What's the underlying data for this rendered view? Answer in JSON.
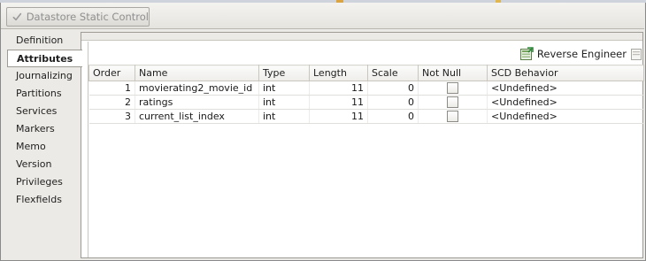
{
  "toolbar": {
    "static_control_label": "Datastore Static Control"
  },
  "nav": {
    "items": [
      {
        "label": "Definition"
      },
      {
        "label": "Attributes"
      },
      {
        "label": "Journalizing"
      },
      {
        "label": "Partitions"
      },
      {
        "label": "Services"
      },
      {
        "label": "Markers"
      },
      {
        "label": "Memo"
      },
      {
        "label": "Version"
      },
      {
        "label": "Privileges"
      },
      {
        "label": "Flexfields"
      }
    ],
    "active": "Attributes"
  },
  "actions": {
    "reverse_engineer_label": "Reverse Engineer"
  },
  "table": {
    "headers": [
      "Order",
      "Name",
      "Type",
      "Length",
      "Scale",
      "Not Null",
      "SCD Behavior"
    ],
    "rows": [
      {
        "order": "1",
        "name": "movierating2_movie_id",
        "type": "int",
        "length": "11",
        "scale": "0",
        "not_null": false,
        "scd": "<Undefined>"
      },
      {
        "order": "2",
        "name": "ratings",
        "type": "int",
        "length": "11",
        "scale": "0",
        "not_null": false,
        "scd": "<Undefined>"
      },
      {
        "order": "3",
        "name": "current_list_index",
        "type": "int",
        "length": "11",
        "scale": "0",
        "not_null": false,
        "scd": "<Undefined>"
      }
    ]
  }
}
